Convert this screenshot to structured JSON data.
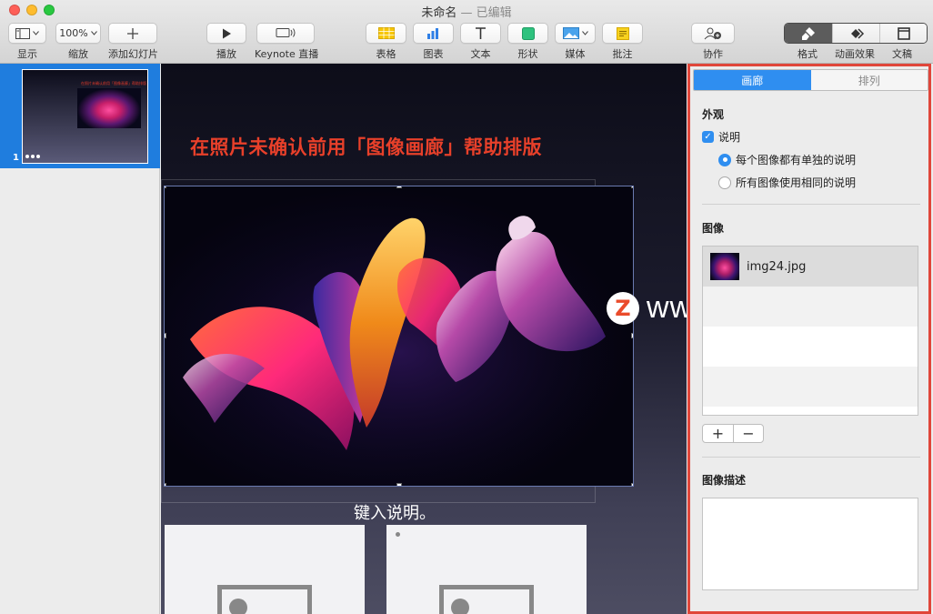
{
  "window": {
    "title": "未命名",
    "title_sep": " — ",
    "title_status": "已编辑"
  },
  "colors": {
    "accent": "#2f8ef0",
    "title_red": "#e8402a",
    "highlight_border": "#e0463a"
  },
  "toolbar": {
    "view_label": "显示",
    "zoom_value": "100%",
    "zoom_label": "缩放",
    "add_slide_label": "添加幻灯片",
    "play_label": "播放",
    "keynote_live_label": "Keynote 直播",
    "table_label": "表格",
    "chart_label": "图表",
    "text_label": "文本",
    "shape_label": "形状",
    "media_label": "媒体",
    "comment_label": "批注",
    "collaborate_label": "协作",
    "format_label": "格式",
    "animate_label": "动画效果",
    "document_label": "文稿"
  },
  "navigator": {
    "slides": [
      {
        "number": "1",
        "title": "在照片未确认前用「图像画廊」帮助排版"
      }
    ]
  },
  "slide": {
    "title": "在照片未确认前用「图像画廊」帮助排版",
    "caption": "键入说明。"
  },
  "watermark": {
    "logo_letter": "Z",
    "text": "www.MacZ.com"
  },
  "inspector": {
    "tabs": [
      {
        "label": "画廊",
        "active": true
      },
      {
        "label": "排列",
        "active": false
      }
    ],
    "appearance_heading": "外观",
    "caption_checkbox_label": "说明",
    "caption_checked": true,
    "radio_each": "每个图像都有单独的说明",
    "radio_same": "所有图像使用相同的说明",
    "radio_selected": "每个图像都有单独的说明",
    "images_heading": "图像",
    "images": [
      {
        "name": "img24.jpg"
      }
    ],
    "add_label": "+",
    "remove_label": "−",
    "description_heading": "图像描述",
    "description_value": ""
  }
}
